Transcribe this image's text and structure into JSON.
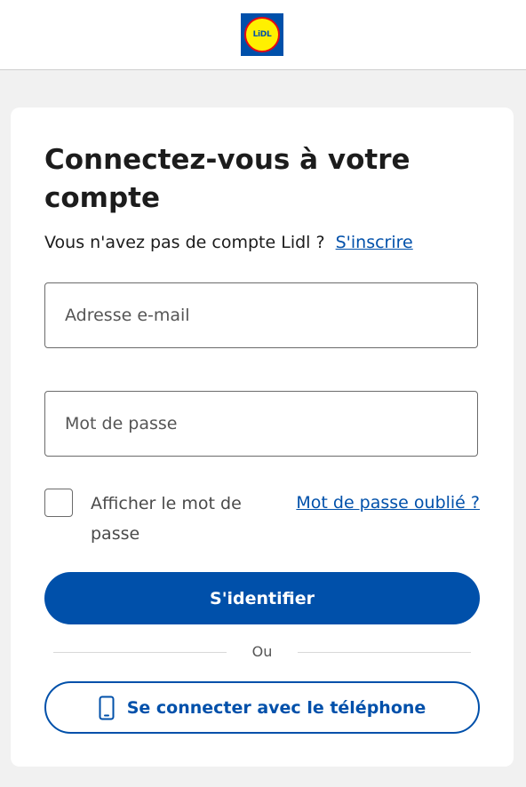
{
  "header": {
    "logo_text": "LiDL"
  },
  "login": {
    "title": "Connectez-vous à votre compte",
    "no_account_text": "Vous n'avez pas de compte Lidl ?",
    "signup_link": "S'inscrire",
    "email_placeholder": "Adresse e-mail",
    "password_placeholder": "Mot de passe",
    "show_password_label": "Afficher le mot de passe",
    "forgot_password_link": "Mot de passe oublié ?",
    "submit_label": "S'identifier",
    "divider_text": "Ou",
    "phone_login_label": "Se connecter avec le téléphone"
  },
  "colors": {
    "brand_blue": "#0050aa",
    "brand_yellow": "#fff000",
    "brand_red": "#e60a14"
  },
  "icons": {
    "phone": "mobile-phone-icon"
  }
}
